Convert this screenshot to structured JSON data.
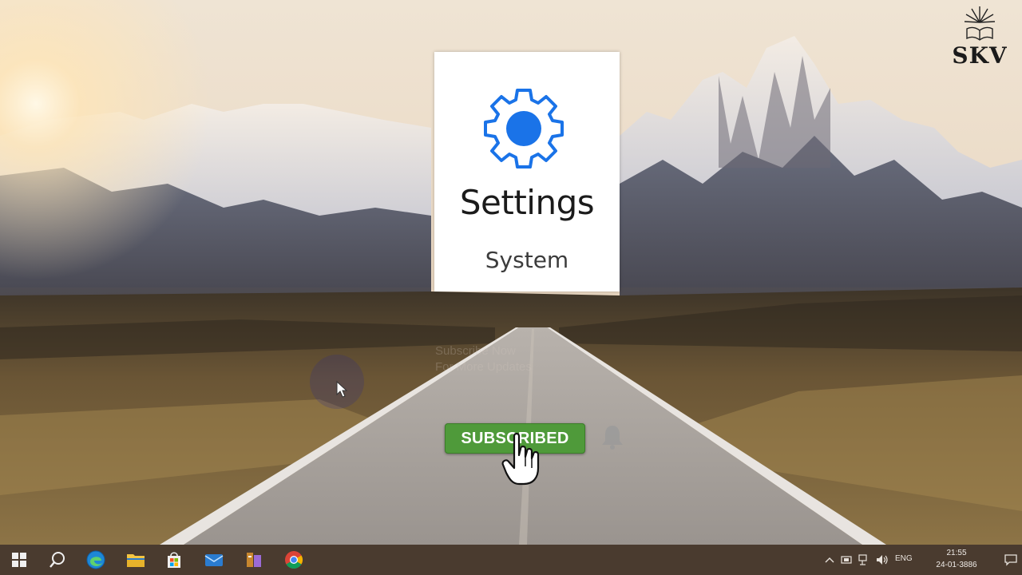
{
  "logo": {
    "text": "SKV"
  },
  "settings_tile": {
    "icon": "gear-icon",
    "title": "Settings",
    "subtitle": "System",
    "accent": "#1a73e8"
  },
  "ghost_overlay": {
    "line1": "Subscribe Now",
    "line2": "For More Updates"
  },
  "subscribe": {
    "label": "SUBSCRIBED",
    "color": "#4f9a3a"
  },
  "taskbar": {
    "pinned": [
      {
        "name": "start",
        "icon": "windows-icon"
      },
      {
        "name": "search",
        "icon": "search-icon"
      },
      {
        "name": "edge",
        "icon": "edge-icon"
      },
      {
        "name": "file-explorer",
        "icon": "folder-icon"
      },
      {
        "name": "store",
        "icon": "store-icon"
      },
      {
        "name": "mail",
        "icon": "mail-icon"
      },
      {
        "name": "app",
        "icon": "app-icon"
      },
      {
        "name": "chrome",
        "icon": "chrome-icon"
      }
    ],
    "tray": {
      "language": "ENG",
      "time": "21:55",
      "date": "24-01-3886"
    }
  }
}
